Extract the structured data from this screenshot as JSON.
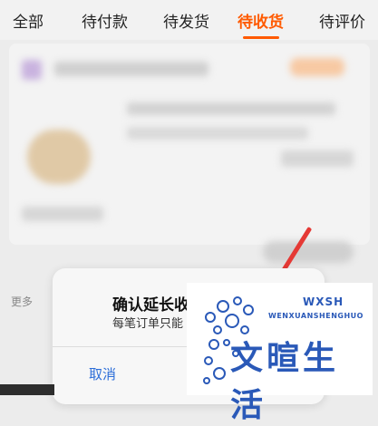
{
  "tabs": [
    {
      "label": "全部"
    },
    {
      "label": "待付款"
    },
    {
      "label": "待发货"
    },
    {
      "label": "待收货"
    },
    {
      "label": "待评价"
    }
  ],
  "active_tab": "待收货",
  "more_text": "更多",
  "dialog": {
    "title": "确认延长收",
    "description": "每笔订单只能",
    "cancel_label": "取消"
  },
  "watermark": {
    "tag": "WXSH",
    "subtitle": "WENXUANSHENGHUO",
    "text": "文暄生活"
  },
  "colors": {
    "accent": "#ff5a00",
    "link": "#2b6dd8",
    "watermark": "#2a59b8",
    "pointer": "#e53935"
  }
}
